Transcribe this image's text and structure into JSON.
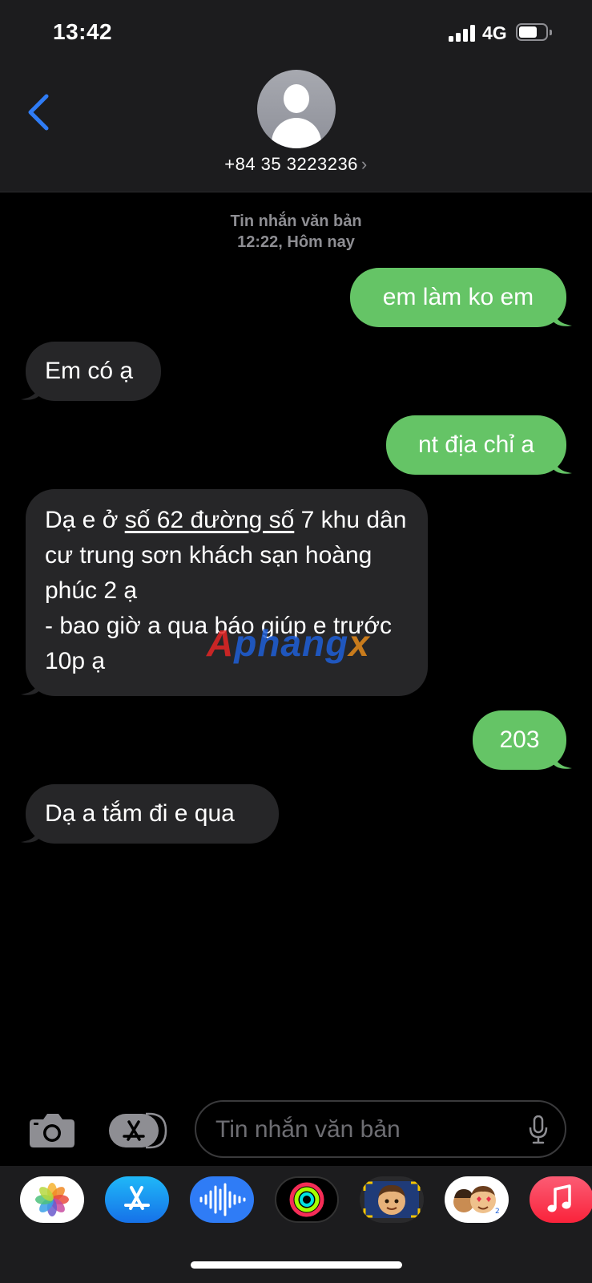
{
  "status_bar": {
    "time": "13:42",
    "network": "4G"
  },
  "header": {
    "contact": "+84 35 3223236"
  },
  "conversation": {
    "timestamp_type": "Tin nhắn văn bản",
    "timestamp_time": "12:22, Hôm nay",
    "messages": [
      {
        "direction": "outgoing",
        "text": "em làm ko em"
      },
      {
        "direction": "incoming",
        "text": "Em có ạ"
      },
      {
        "direction": "outgoing",
        "text": "nt địa chỉ a"
      },
      {
        "direction": "incoming",
        "text_pre": " Dạ e ở ",
        "text_link": "số 62 đường số",
        "text_post": " 7 khu dân cư trung sơn khách sạn hoàng phúc 2 ạ\n- bao giờ a qua báo giúp e trước 10p ạ"
      },
      {
        "direction": "outgoing",
        "text": "203"
      },
      {
        "direction": "incoming",
        "text": "Dạ a tắm đi e qua"
      }
    ]
  },
  "watermark": {
    "part1": "A",
    "part2": "phang",
    "part3": "x"
  },
  "input_bar": {
    "placeholder": "Tin nhắn văn bản"
  },
  "app_drawer": {
    "apps": [
      "photos-icon",
      "app-store-icon",
      "audio-message-icon",
      "activity-icon",
      "memoji-icon",
      "memoji-stickers-icon",
      "music-icon"
    ]
  },
  "colors": {
    "outgoing_bubble": "#65c466",
    "incoming_bubble": "#262628",
    "accent": "#2f7cf6"
  }
}
